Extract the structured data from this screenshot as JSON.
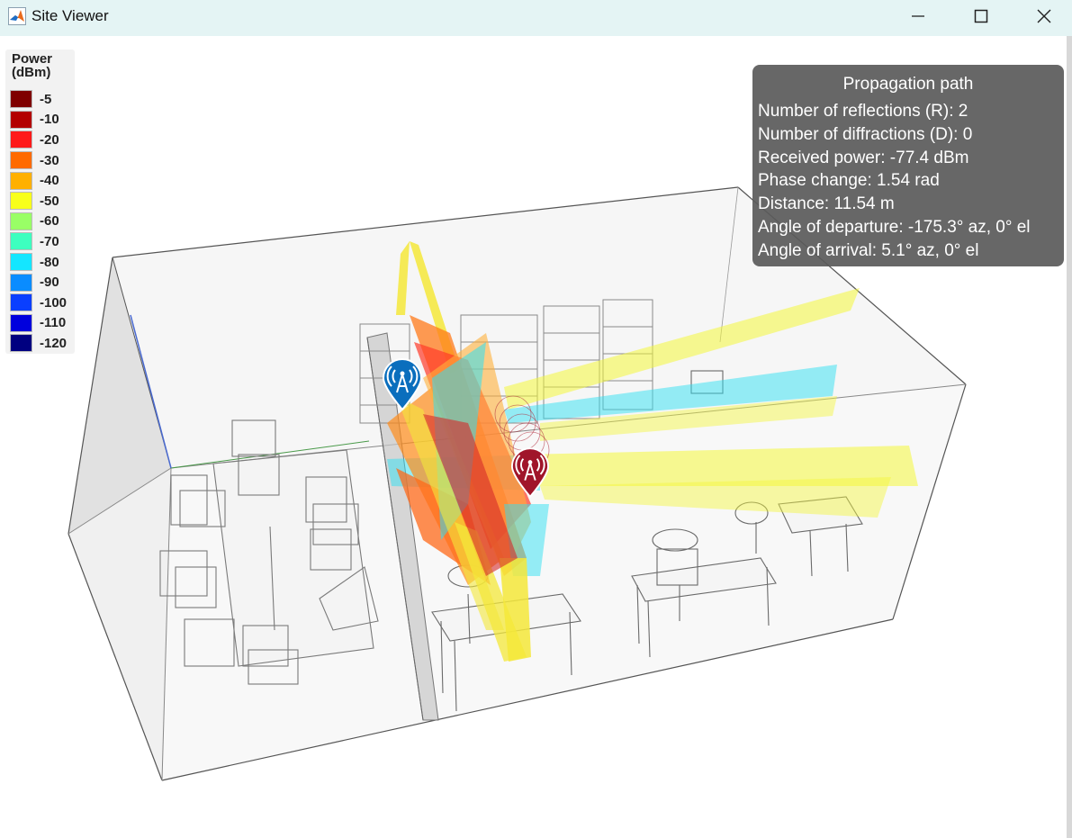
{
  "window": {
    "title": "Site Viewer",
    "icon": "matlab-icon"
  },
  "window_controls": {
    "minimize_icon": "minimize-icon",
    "maximize_icon": "maximize-icon",
    "close_icon": "close-icon"
  },
  "legend": {
    "title_line1": "Power",
    "title_line2": "(dBm)",
    "items": [
      {
        "label": "-5",
        "color": "#7f0000"
      },
      {
        "label": "-10",
        "color": "#b30000"
      },
      {
        "label": "-20",
        "color": "#ff1a1a"
      },
      {
        "label": "-30",
        "color": "#ff6a00"
      },
      {
        "label": "-40",
        "color": "#ffb000"
      },
      {
        "label": "-50",
        "color": "#f8ff1a"
      },
      {
        "label": "-60",
        "color": "#99ff66"
      },
      {
        "label": "-70",
        "color": "#3dffbf"
      },
      {
        "label": "-80",
        "color": "#14e6ff"
      },
      {
        "label": "-90",
        "color": "#0a8cff"
      },
      {
        "label": "-100",
        "color": "#0a3fff"
      },
      {
        "label": "-110",
        "color": "#0000dd"
      },
      {
        "label": "-120",
        "color": "#000080"
      }
    ]
  },
  "info_panel": {
    "title": "Propagation path",
    "lines": [
      "Number of reflections (R): 2",
      "Number of diffractions (D): 0",
      "Received power: -77.4 dBm",
      "Phase change: 1.54 rad",
      "Distance: 11.54 m",
      "Angle of departure: -175.3° az, 0° el",
      "Angle of arrival: 5.1° az, 0° el"
    ]
  },
  "markers": {
    "transmitter": {
      "icon": "antenna-tower-icon",
      "color": "#0a6ebd"
    },
    "receiver": {
      "icon": "antenna-tower-icon",
      "color": "#a0152a"
    }
  }
}
